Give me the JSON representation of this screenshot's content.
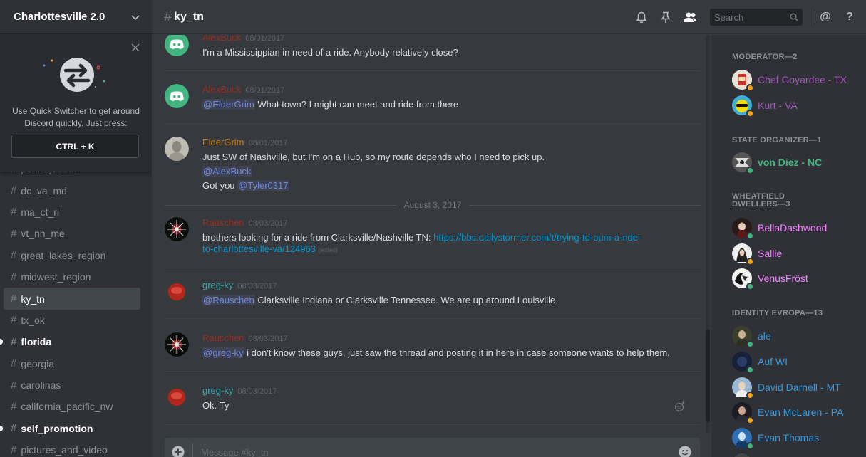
{
  "colors": {
    "online": "#43b581",
    "idle": "#faa61a",
    "moderator": "#9b59b6",
    "state_organizer": "#1abc9c",
    "dwellers": "#f47fff",
    "identity": "#3498db",
    "rauschen": "#992d22",
    "eldergrim": "#c27c0e",
    "greg": "#3aa8a8"
  },
  "server": {
    "name": "Charlottesville 2.0"
  },
  "quick_switcher": {
    "text_line1": "Use Quick Switcher to get around",
    "text_line2": "Discord quickly. Just press:",
    "shortcut": "CTRL + K"
  },
  "channels": [
    {
      "name": "pennsylvania",
      "state": "normal"
    },
    {
      "name": "dc_va_md",
      "state": "normal"
    },
    {
      "name": "ma_ct_ri",
      "state": "normal"
    },
    {
      "name": "vt_nh_me",
      "state": "normal"
    },
    {
      "name": "great_lakes_region",
      "state": "normal"
    },
    {
      "name": "midwest_region",
      "state": "normal"
    },
    {
      "name": "ky_tn",
      "state": "active"
    },
    {
      "name": "tx_ok",
      "state": "normal"
    },
    {
      "name": "florida",
      "state": "unread"
    },
    {
      "name": "georgia",
      "state": "normal"
    },
    {
      "name": "carolinas",
      "state": "normal"
    },
    {
      "name": "california_pacific_nw",
      "state": "normal"
    },
    {
      "name": "self_promotion",
      "state": "unread"
    },
    {
      "name": "pictures_and_video",
      "state": "normal"
    }
  ],
  "header": {
    "hash": "#",
    "channel_name": "ky_tn",
    "search_placeholder": "Search",
    "at": "@",
    "help": "?"
  },
  "messages": [
    {
      "user": "AlexBuck",
      "time": "08/01/2017",
      "text": "I'm a Mississippian in need of a ride. Anybody relatively close?"
    },
    {
      "user": "AlexBuck",
      "time": "08/01/2017",
      "mention": "@ElderGrim",
      "text": "What town? I might can meet and ride from there"
    },
    {
      "user": "ElderGrim",
      "time": "08/01/2017",
      "text": "Just SW of Nashville, but I'm on a Hub, so my route depends who I need to pick up.",
      "mention1": "@AlexBuck",
      "text2": "Got you",
      "mention2": "@Tyler0317"
    },
    {
      "user": "Rauschen",
      "time": "08/03/2017",
      "text": "brothers looking for a ride from Clarksville/Nashville TN:",
      "link1": "https://bbs.dailystormer.com/t/trying-to-bum-a-ride-",
      "link2": "to-charlottesville-va/124963",
      "edited": "(edited)"
    },
    {
      "user": "greg-ky",
      "time": "08/03/2017",
      "mention": "@Rauschen",
      "text": "Clarksville Indiana or Clarksville Tennessee. We are up around Louisville"
    },
    {
      "user": "Rauschen",
      "time": "08/03/2017",
      "mention": "@greg-ky",
      "text": "i don't know these guys, just saw the thread and posting it in here in case someone wants to help them."
    },
    {
      "user": "greg-ky",
      "time": "08/03/2017",
      "text": "Ok. Ty"
    }
  ],
  "date_divider": "August 3, 2017",
  "composer": {
    "placeholder": "Message #ky_tn"
  },
  "members": {
    "groups": [
      {
        "title": "MODERATOR—2",
        "members": [
          {
            "name": "Chef Goyardee - TX",
            "status": "idle"
          },
          {
            "name": "Kurt - VA",
            "status": "idle"
          }
        ]
      },
      {
        "title": "STATE ORGANIZER—1",
        "members": [
          {
            "name": "von Diez - NC",
            "status": "online"
          }
        ]
      },
      {
        "title_line1": "WHEATFIELD",
        "title_line2": "DWELLERS—3",
        "members": [
          {
            "name": "BellaDashwood",
            "status": "online"
          },
          {
            "name": "Sallie",
            "status": "idle"
          },
          {
            "name": "VenusFröst",
            "status": "online"
          }
        ]
      },
      {
        "title": "IDENTITY EVROPA—13",
        "members": [
          {
            "name": "ale",
            "status": "online"
          },
          {
            "name": "Auf WI",
            "status": "online"
          },
          {
            "name": "David Darnell - MT",
            "status": "idle"
          },
          {
            "name": "Evan McLaren - PA",
            "status": "idle"
          },
          {
            "name": "Evan Thomas",
            "status": "online"
          }
        ]
      }
    ]
  }
}
